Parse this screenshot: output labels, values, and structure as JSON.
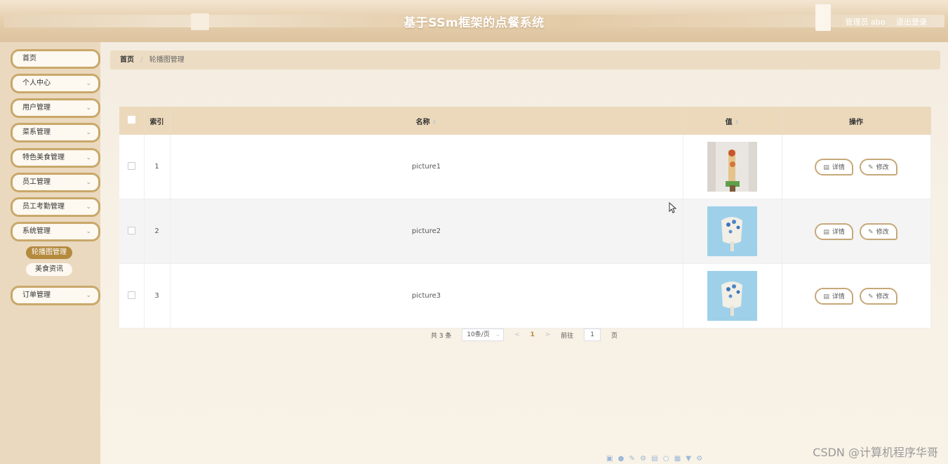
{
  "header": {
    "title": "基于SSm框架的点餐系统",
    "admin_label": "管理员 abo",
    "logout_label": "退出登录"
  },
  "sidebar": {
    "items": [
      {
        "label": "首页",
        "has_chevron": false
      },
      {
        "label": "个人中心",
        "has_chevron": true
      },
      {
        "label": "用户管理",
        "has_chevron": true
      },
      {
        "label": "菜系管理",
        "has_chevron": true
      },
      {
        "label": "特色美食管理",
        "has_chevron": true
      },
      {
        "label": "员工管理",
        "has_chevron": true
      },
      {
        "label": "员工考勤管理",
        "has_chevron": true
      },
      {
        "label": "系统管理",
        "has_chevron": true
      },
      {
        "label": "订单管理",
        "has_chevron": true
      }
    ],
    "sub_items": [
      {
        "label": "轮播图管理",
        "active": true
      },
      {
        "label": "美食资讯",
        "active": false
      }
    ]
  },
  "breadcrumb": {
    "home": "首页",
    "separator": "/",
    "current": "轮播图管理"
  },
  "table": {
    "columns": [
      "索引",
      "名称",
      "值",
      "操作"
    ],
    "rows": [
      {
        "index": "1",
        "name": "picture1"
      },
      {
        "index": "2",
        "name": "picture2"
      },
      {
        "index": "3",
        "name": "picture3"
      }
    ],
    "detail_label": "详情",
    "edit_label": "修改"
  },
  "pagination": {
    "total": "共 3 条",
    "page_size": "10条/页",
    "prev": "<",
    "current_page": "1",
    "next": ">",
    "goto_label": "前往",
    "goto_value": "1",
    "page_unit": "页"
  },
  "watermark": "CSDN @计算机程序华哥",
  "colors": {
    "accent": "#b48a3e",
    "header_bg": "#e6cfae",
    "sidebar_bg": "#ead9bf",
    "table_header_bg": "#ecd9bc"
  }
}
